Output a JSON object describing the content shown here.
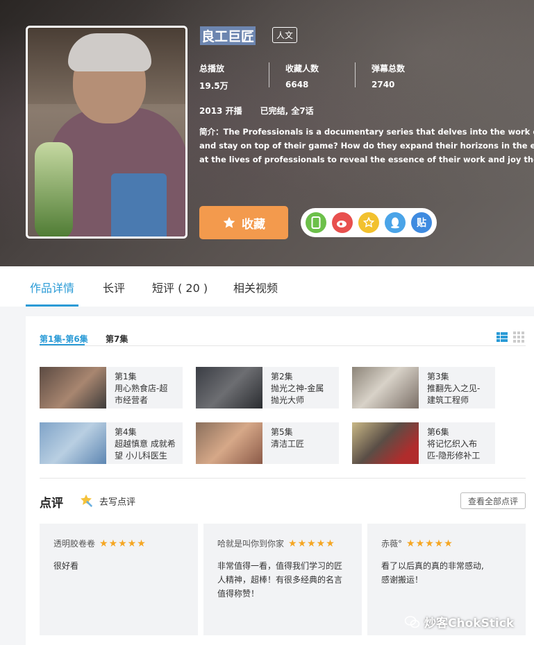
{
  "hero": {
    "title": "良工巨匠",
    "tag": "人文",
    "stats": [
      {
        "label": "总播放",
        "value": "19.5万"
      },
      {
        "label": "收藏人数",
        "value": "6648"
      },
      {
        "label": "弹幕总数",
        "value": "2740"
      }
    ],
    "year": "2013 开播",
    "status": "已完结, 全7话",
    "desc_lines": [
      "简介：The Professionals is a documentary series that delves into the work of outstanding p",
      "and stay on top of their game? How do they expand their horizons in the ever-changing wo",
      "at the lives of professionals to reveal the essence of their work and joy they receive from th"
    ],
    "favorite_label": "收藏",
    "share_icons": [
      {
        "name": "mobile-icon",
        "color": "#6cc04a",
        "glyph": "▯"
      },
      {
        "name": "weibo-icon",
        "color": "#e8504e",
        "glyph": "◉"
      },
      {
        "name": "qzone-icon",
        "color": "#f2c12e",
        "glyph": "☆"
      },
      {
        "name": "qq-icon",
        "color": "#4aa4e8",
        "glyph": "♟"
      },
      {
        "name": "tieba-icon",
        "color": "#3f8be0",
        "glyph": "贴"
      }
    ]
  },
  "tabs": [
    "作品详情",
    "长评",
    "短评 ( 20 )",
    "相关视频"
  ],
  "episodes": {
    "segments": [
      "第1集-第6集",
      "第7集"
    ],
    "items": [
      {
        "num": "第1集",
        "line1": "用心熟食店-超",
        "line2": "市经营者"
      },
      {
        "num": "第2集",
        "line1": "抛光之神-金属",
        "line2": "抛光大师"
      },
      {
        "num": "第3集",
        "line1": "推翻先入之见-",
        "line2": "建筑工程师"
      },
      {
        "num": "第4集",
        "line1": "超越慎意 成就希",
        "line2": "望 小儿科医生"
      },
      {
        "num": "第5集",
        "line1": "清洁工匠",
        "line2": ""
      },
      {
        "num": "第6集",
        "line1": "将记忆织入布",
        "line2": "匹-隐形修补工"
      }
    ]
  },
  "reviews": {
    "title": "点评",
    "write_label": "去写点评",
    "all_label": "查看全部点评",
    "stars": "★★★★★",
    "cards": [
      {
        "user": "透明胶卷卷",
        "text1": "很好看",
        "text2": "",
        "text3": ""
      },
      {
        "user": "哈就是叫你到你家",
        "text1": "非常值得一看，值得我们学习的匠",
        "text2": "人精神，超棒！有很多经典的名言",
        "text3": "值得称赞！"
      },
      {
        "user": "赤薇°",
        "text1": "看了以后真的真的非常感动,",
        "text2": "感谢搬运！",
        "text3": ""
      }
    ]
  },
  "watermark": "炒客ChokStick"
}
